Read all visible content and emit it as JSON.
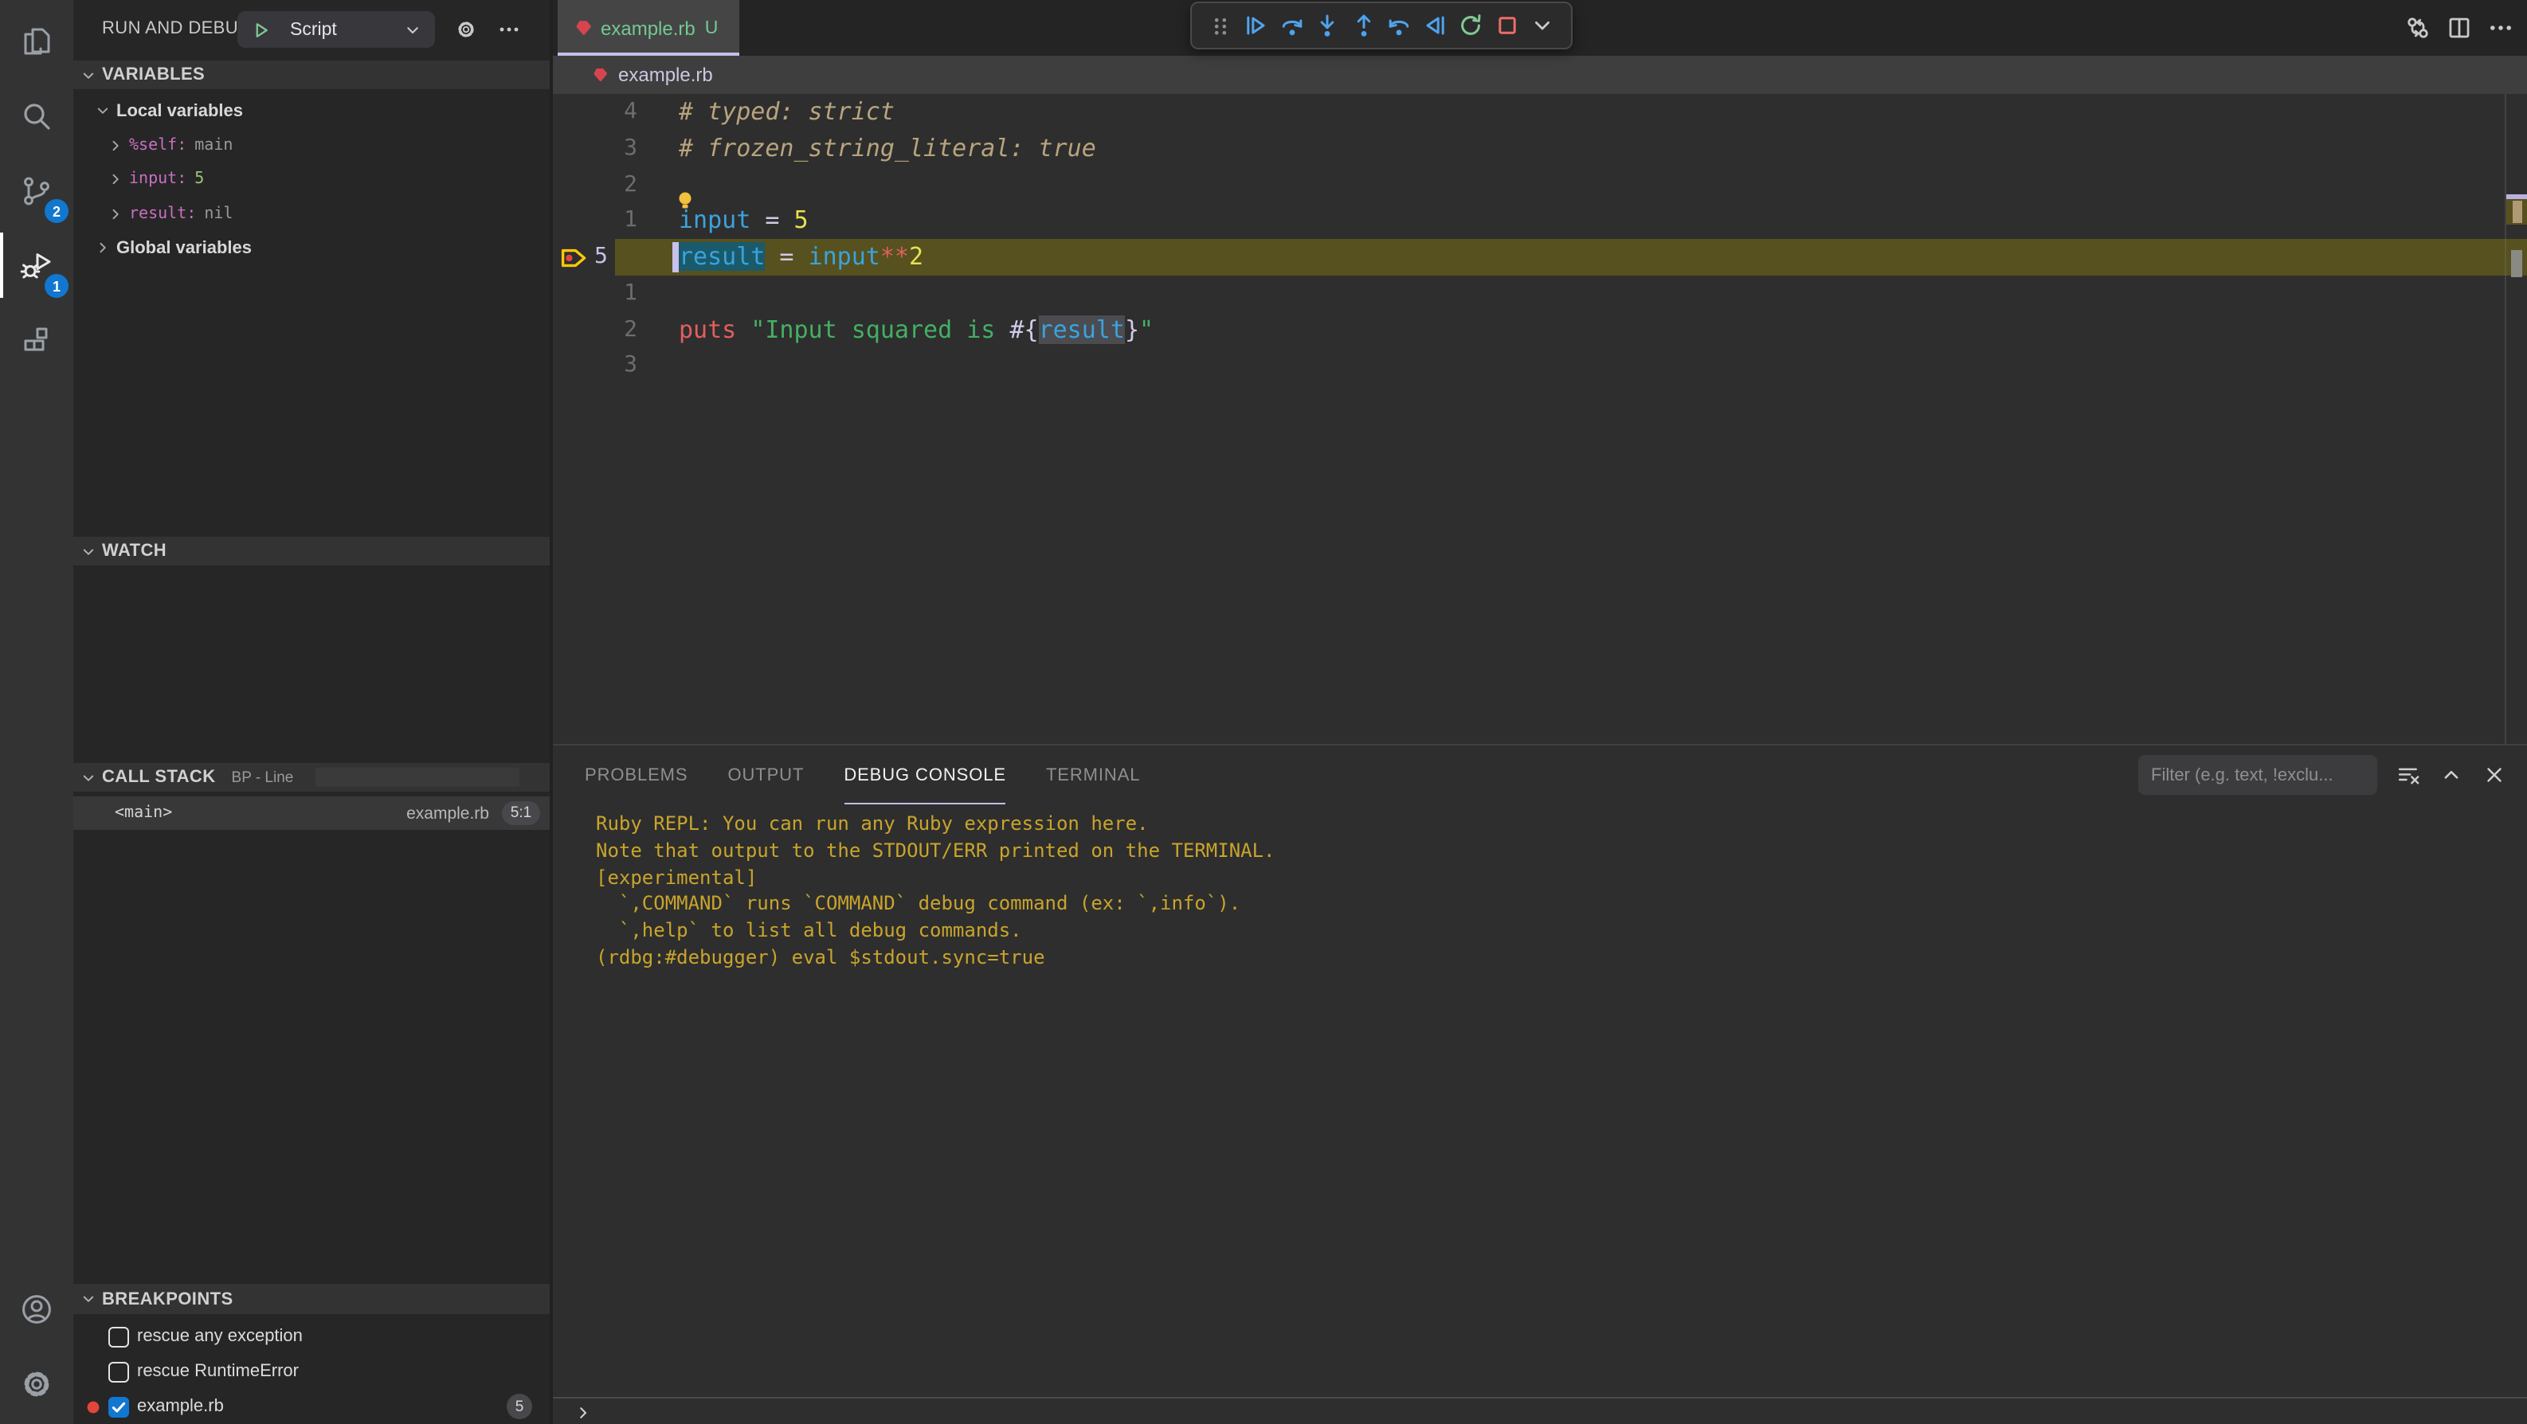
{
  "colors": {
    "accent_lavender": "#c6bdeb",
    "badge_blue": "#1177cf",
    "breakpoint_red": "#e5443b",
    "debug_icon_blue": "#4fa3ee",
    "restart_green": "#81c995",
    "stop_red": "#ef6d66",
    "console_gold": "#c9a42c",
    "current_line_olive": "#56511f",
    "selection_teal": "#1a5a6b",
    "tab_git_green": "#73c991"
  },
  "activity_bar": {
    "items": [
      {
        "id": "explorer",
        "icon": "files-icon",
        "badge": null,
        "active": false
      },
      {
        "id": "search",
        "icon": "search-icon",
        "badge": null,
        "active": false
      },
      {
        "id": "source-control",
        "icon": "source-control-icon",
        "badge": "2",
        "active": false
      },
      {
        "id": "run-and-debug",
        "icon": "debug-icon",
        "badge": "1",
        "active": true
      },
      {
        "id": "extensions",
        "icon": "extensions-icon",
        "badge": null,
        "active": false
      }
    ],
    "bottom_items": [
      {
        "id": "accounts",
        "icon": "account-icon"
      },
      {
        "id": "settings",
        "icon": "gear-icon"
      }
    ]
  },
  "sidebar": {
    "title": "RUN AND DEBUG",
    "launch": {
      "label": "Script"
    },
    "variables": {
      "header": "VARIABLES",
      "groups": [
        {
          "label": "Local variables",
          "expanded": true,
          "children": [
            {
              "name": "%self:",
              "value": "main",
              "value_style": "muted"
            },
            {
              "name": "input:",
              "value": "5",
              "value_style": "number"
            },
            {
              "name": "result:",
              "value": "nil",
              "value_style": "muted"
            }
          ]
        },
        {
          "label": "Global variables",
          "expanded": false,
          "children": []
        }
      ]
    },
    "watch": {
      "header": "WATCH"
    },
    "call_stack": {
      "header": "CALL STACK",
      "description": "BP - Line",
      "frames": [
        {
          "name": "<main>",
          "file": "example.rb",
          "location": "5:1"
        }
      ]
    },
    "breakpoints": {
      "header": "BREAKPOINTS",
      "items": [
        {
          "label": "rescue any exception",
          "checked": false,
          "dot": false,
          "badge": null
        },
        {
          "label": "rescue RuntimeError",
          "checked": false,
          "dot": false,
          "badge": null
        },
        {
          "label": "example.rb",
          "checked": true,
          "dot": true,
          "badge": "5"
        }
      ]
    }
  },
  "editor": {
    "tab": {
      "file": "example.rb",
      "git_status": "U"
    },
    "breadcrumb": {
      "file": "example.rb"
    },
    "debug_toolbar": {
      "buttons": [
        {
          "id": "drag",
          "icon": "gripper-icon"
        },
        {
          "id": "continue",
          "icon": "continue-icon"
        },
        {
          "id": "step-over",
          "icon": "step-over-icon"
        },
        {
          "id": "step-into",
          "icon": "step-into-icon"
        },
        {
          "id": "step-out",
          "icon": "step-out-icon"
        },
        {
          "id": "step-back",
          "icon": "step-back-icon"
        },
        {
          "id": "reverse-continue",
          "icon": "reverse-continue-icon"
        },
        {
          "id": "restart",
          "icon": "restart-icon"
        },
        {
          "id": "stop",
          "icon": "stop-icon"
        },
        {
          "id": "more",
          "icon": "chevron-down-icon"
        }
      ]
    },
    "code": {
      "lines": [
        {
          "gutter": "4",
          "tokens": [
            {
              "t": "# typed: strict",
              "s": "comment"
            }
          ]
        },
        {
          "gutter": "3",
          "tokens": [
            {
              "t": "# frozen_string_literal: true",
              "s": "comment"
            }
          ]
        },
        {
          "gutter": "2",
          "tokens": []
        },
        {
          "gutter": "1",
          "lightbulb": true,
          "tokens": [
            {
              "t": "input",
              "s": "ident"
            },
            {
              "t": " = ",
              "s": "op"
            },
            {
              "t": "5",
              "s": "num"
            }
          ]
        },
        {
          "gutter": "5",
          "current": true,
          "breakpoint": true,
          "cursor": true,
          "tokens": [
            {
              "t": "result",
              "s": "ident",
              "bg": "selection"
            },
            {
              "t": " = ",
              "s": "op"
            },
            {
              "t": "input",
              "s": "ident"
            },
            {
              "t": "**",
              "s": "red"
            },
            {
              "t": "2",
              "s": "num"
            }
          ]
        },
        {
          "gutter": "1",
          "tokens": []
        },
        {
          "gutter": "2",
          "tokens": [
            {
              "t": "puts",
              "s": "red"
            },
            {
              "t": " ",
              "s": "op"
            },
            {
              "t": "\"Input squared is ",
              "s": "str"
            },
            {
              "t": "#{",
              "s": "op"
            },
            {
              "t": "result",
              "s": "ident",
              "bg": "word"
            },
            {
              "t": "}",
              "s": "op"
            },
            {
              "t": "\"",
              "s": "str"
            }
          ]
        },
        {
          "gutter": "3",
          "tokens": []
        }
      ]
    }
  },
  "panel": {
    "tabs": [
      {
        "label": "PROBLEMS",
        "active": false
      },
      {
        "label": "OUTPUT",
        "active": false
      },
      {
        "label": "DEBUG CONSOLE",
        "active": true
      },
      {
        "label": "TERMINAL",
        "active": false
      }
    ],
    "filter_placeholder": "Filter (e.g. text, !exclu...",
    "console_lines": [
      "Ruby REPL: You can run any Ruby expression here.",
      "Note that output to the STDOUT/ERR printed on the TERMINAL.",
      "[experimental]",
      "  `,COMMAND` runs `COMMAND` debug command (ex: `,info`).",
      "  `,help` to list all debug commands.",
      "(rdbg:#debugger) eval $stdout.sync=true"
    ]
  }
}
